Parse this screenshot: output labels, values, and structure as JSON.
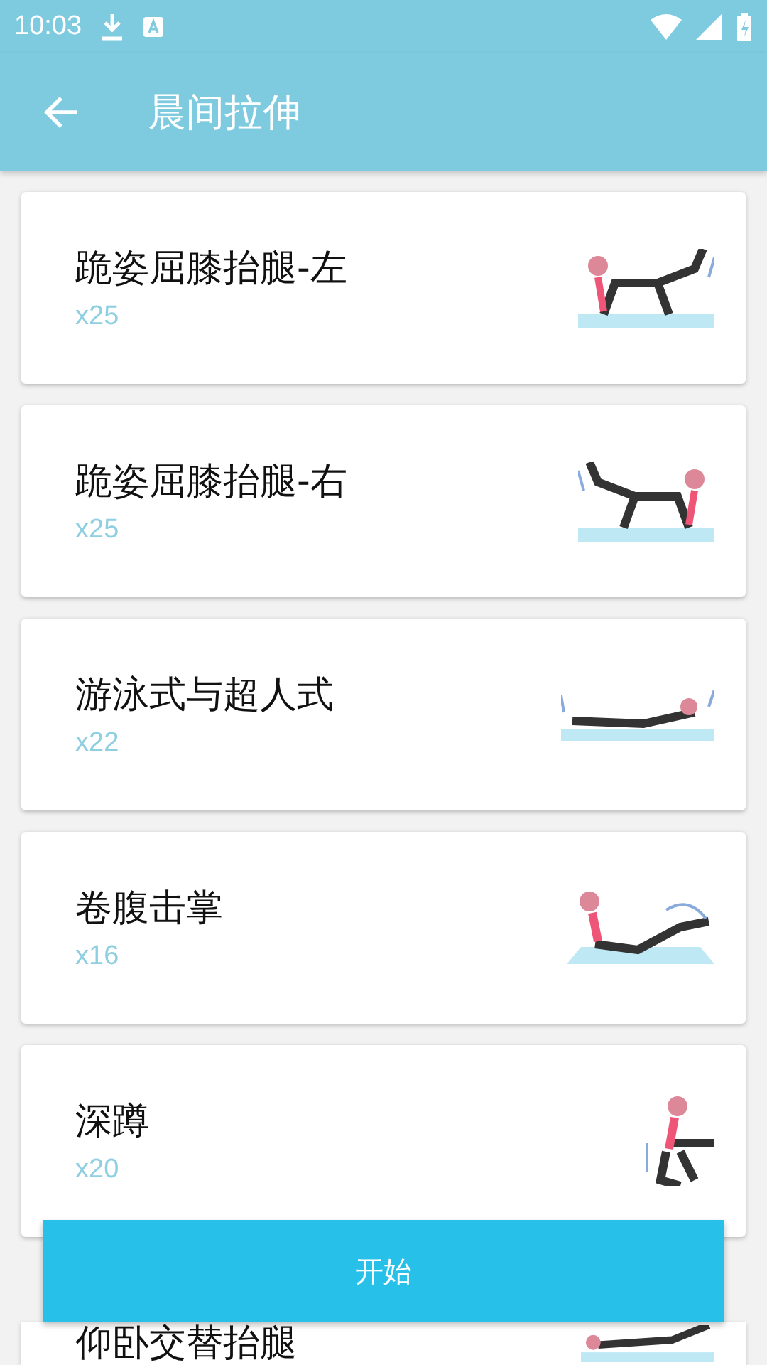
{
  "status_bar": {
    "time": "10:03"
  },
  "app_bar": {
    "title": "晨间拉伸"
  },
  "exercises": [
    {
      "name": "跪姿屈膝抬腿-左",
      "reps": "x25",
      "kind": "kneel-left"
    },
    {
      "name": "跪姿屈膝抬腿-右",
      "reps": "x25",
      "kind": "kneel-right"
    },
    {
      "name": "游泳式与超人式",
      "reps": "x22",
      "kind": "prone"
    },
    {
      "name": "卷腹击掌",
      "reps": "x16",
      "kind": "crunch"
    },
    {
      "name": "深蹲",
      "reps": "x20",
      "kind": "squat"
    },
    {
      "name": "仰卧交替抬腿",
      "kind": "supine"
    }
  ],
  "start_button": {
    "label": "开始"
  }
}
